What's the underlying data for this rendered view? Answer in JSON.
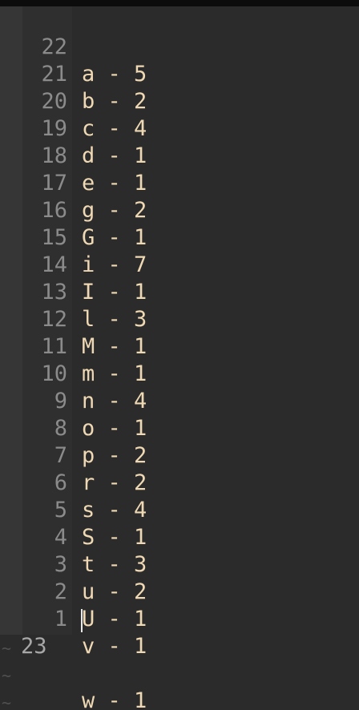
{
  "editor": {
    "lines": [
      {
        "number": "22",
        "text": "a - 5"
      },
      {
        "number": "21",
        "text": "b - 2"
      },
      {
        "number": "20",
        "text": "c - 4"
      },
      {
        "number": "19",
        "text": "d - 1"
      },
      {
        "number": "18",
        "text": "e - 1"
      },
      {
        "number": "17",
        "text": "g - 2"
      },
      {
        "number": "16",
        "text": "G - 1"
      },
      {
        "number": "15",
        "text": "i - 7"
      },
      {
        "number": "14",
        "text": "I - 1"
      },
      {
        "number": "13",
        "text": "l - 3"
      },
      {
        "number": "12",
        "text": "M - 1"
      },
      {
        "number": "11",
        "text": "m - 1"
      },
      {
        "number": "10",
        "text": "n - 4"
      },
      {
        "number": "9",
        "text": "o - 1"
      },
      {
        "number": "8",
        "text": "p - 2"
      },
      {
        "number": "7",
        "text": "r - 2"
      },
      {
        "number": "6",
        "text": "s - 4"
      },
      {
        "number": "5",
        "text": "S - 1"
      },
      {
        "number": "4",
        "text": "t - 3"
      },
      {
        "number": "3",
        "text": "u - 2"
      },
      {
        "number": "2",
        "text": "U - 1"
      },
      {
        "number": "1",
        "text": "v - 1"
      }
    ],
    "current_line": {
      "number": "23",
      "text": "w - 1"
    },
    "empty_line_markers": [
      "~",
      "~",
      "~"
    ],
    "colors": {
      "background": "#2b2b2b",
      "gutter": "#2f2f2f",
      "line_number": "#8b8b8b",
      "text": "#efd8b4",
      "cursor": "#e8e8e8",
      "tilde": "#505050"
    }
  }
}
